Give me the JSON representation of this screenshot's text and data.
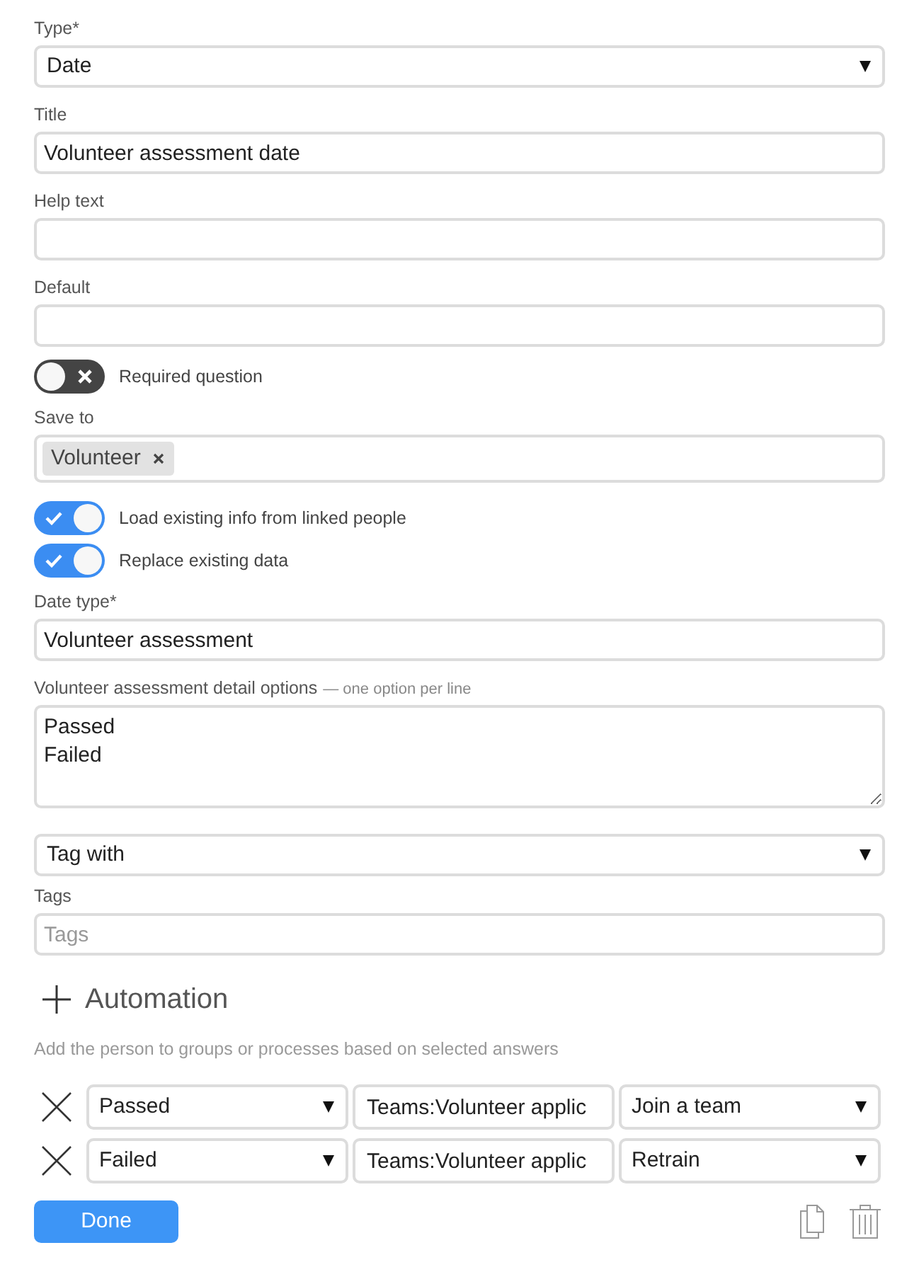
{
  "fields": [
    {
      "kind": "select",
      "label": "Type*",
      "value": "Date"
    },
    {
      "kind": "input",
      "label": "Title",
      "value": "Volunteer assessment date"
    },
    {
      "kind": "input",
      "label": "Help text"
    },
    {
      "kind": "input",
      "label": "Default"
    },
    {
      "kind": "toggle",
      "label": "Required question",
      "on": false
    },
    {
      "kind": "chips",
      "label": "Save to",
      "chips": [
        {
          "label": "Volunteer"
        }
      ]
    },
    {
      "kind": "toggle",
      "label": "Load existing info from linked people",
      "on": true
    },
    {
      "kind": "toggle",
      "label": "Replace existing data",
      "on": true
    },
    {
      "kind": "input",
      "label": "Date type*",
      "value": "Volunteer assessment"
    },
    {
      "kind": "textarea",
      "label": "Volunteer assessment detail options",
      "hint": "— one option per line",
      "value": "Passed\nFailed"
    },
    {
      "kind": "select",
      "value": "Tag with"
    },
    {
      "kind": "input",
      "label": "Tags",
      "placeholder": "Tags"
    }
  ],
  "automation": {
    "title": "Automation",
    "description": "Add the person to groups or processes based on selected answers",
    "rules": [
      {
        "answer": "Passed",
        "group": "Teams:Volunteer applic",
        "action": "Join a team"
      },
      {
        "answer": "Failed",
        "group": "Teams:Volunteer applic",
        "action": "Retrain"
      }
    ]
  },
  "done_button": "Done"
}
